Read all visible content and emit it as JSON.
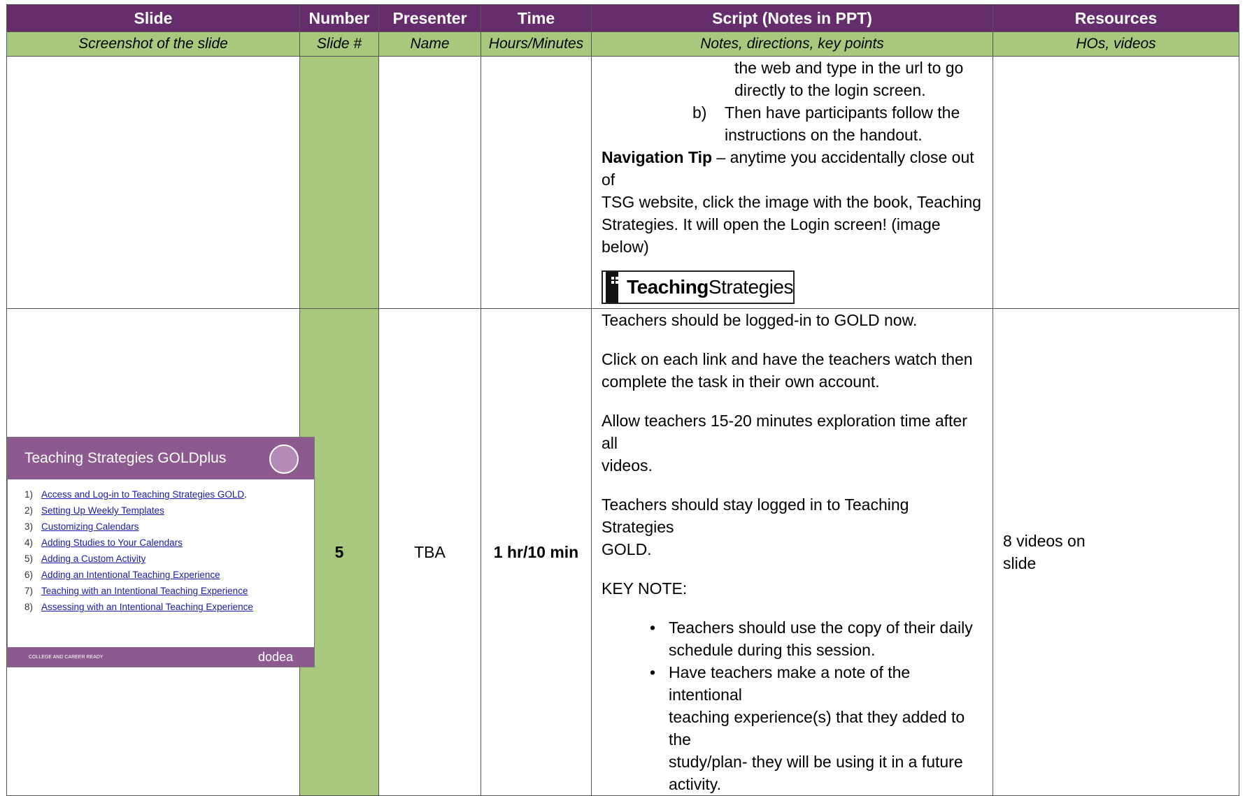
{
  "header": [
    "Slide",
    "Number",
    "Presenter",
    "Time",
    "Script (Notes in PPT)",
    "Resources"
  ],
  "subheader": [
    "Screenshot of the slide",
    "Slide #",
    "Name",
    "Hours/Minutes",
    "Notes, directions, key points",
    "HOs, videos"
  ],
  "row1": {
    "cont1": "the web and type in the url to go",
    "cont2": "directly to the login screen.",
    "b_marker": "b)",
    "b1": "Then have participants follow the",
    "b2": "instructions on the handout.",
    "tip_bold": "Navigation Tip",
    "tip1": " – anytime you accidentally close out of",
    "tip2": "TSG website, click the image with the book, Teaching",
    "tip3": "Strategies. It will open the Login screen! (image below)",
    "logo_bold": "Teaching",
    "logo_rest": "Strategies"
  },
  "row2": {
    "number": "5",
    "presenter": "TBA",
    "time": "1 hr/10 min",
    "p1": "Teachers should be logged-in to GOLD now.",
    "p2a": "Click on each link and have the teachers watch then",
    "p2b": "complete the task in their own account.",
    "p3a": "Allow teachers 15-20 minutes exploration time after all",
    "p3b": "videos.",
    "p4a": "Teachers should stay logged in to Teaching Strategies",
    "p4b": "GOLD.",
    "key": "KEY NOTE:",
    "bullet_symbol": "•",
    "b1a": "Teachers should use the copy of their daily",
    "b1b": "schedule during this session.",
    "b2a": "Have teachers make a note of the intentional",
    "b2b": "teaching experience(s) that they added to the",
    "b2c": "study/plan- they will be using it in a future",
    "b2d": "activity.",
    "res1": "8 videos on",
    "res2": "slide",
    "slide": {
      "title": "Teaching Strategies GOLDplus",
      "items": [
        {
          "n": "1)",
          "t": "Access and Log-in to Teaching Strategies GOLD",
          "suffix": "."
        },
        {
          "n": "2)",
          "t": "Setting Up Weekly Templates",
          "suffix": ""
        },
        {
          "n": "3)",
          "t": "Customizing Calendars",
          "suffix": ""
        },
        {
          "n": "4)",
          "t": "Adding Studies to Your Calendars",
          "suffix": ""
        },
        {
          "n": "5)",
          "t": "Adding a Custom Activity",
          "suffix": ""
        },
        {
          "n": "6)",
          "t": "Adding an Intentional Teaching Experience",
          "suffix": ""
        },
        {
          "n": "7)",
          "t": "Teaching with an Intentional Teaching Experience",
          "suffix": ""
        },
        {
          "n": "8)",
          "t": "Assessing with an Intentional Teaching Experience",
          "suffix": ""
        }
      ],
      "footer_left": "COLLEGE AND CAREER READY",
      "footer_right": "dodea"
    }
  }
}
